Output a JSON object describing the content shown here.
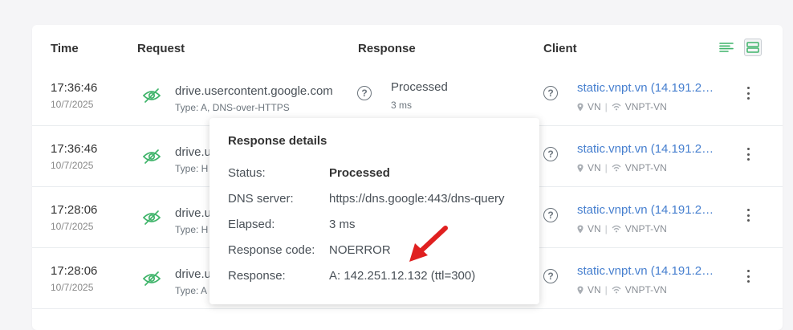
{
  "table": {
    "headers": {
      "time": "Time",
      "request": "Request",
      "response": "Response",
      "client": "Client"
    },
    "rows": [
      {
        "time": "17:36:46",
        "date": "10/7/2025",
        "domain": "drive.usercontent.google.com",
        "type": "Type: A, DNS-over-HTTPS",
        "status": "Processed",
        "elapsed": "3 ms",
        "client": "static.vnpt.vn (14.191.2…",
        "country": "VN",
        "network": "VNPT-VN"
      },
      {
        "time": "17:36:46",
        "date": "10/7/2025",
        "domain": "drive.u",
        "type": "Type: H",
        "status": "",
        "elapsed": "",
        "client": "static.vnpt.vn (14.191.2…",
        "country": "VN",
        "network": "VNPT-VN"
      },
      {
        "time": "17:28:06",
        "date": "10/7/2025",
        "domain": "drive.u",
        "type": "Type: H",
        "status": "",
        "elapsed": "",
        "client": "static.vnpt.vn (14.191.2…",
        "country": "VN",
        "network": "VNPT-VN"
      },
      {
        "time": "17:28:06",
        "date": "10/7/2025",
        "domain": "drive.u",
        "type": "Type: A",
        "status": "",
        "elapsed": "",
        "client": "static.vnpt.vn (14.191.2…",
        "country": "VN",
        "network": "VNPT-VN"
      }
    ]
  },
  "icons": {
    "request": "eye-slash-icon",
    "help": "question-circle-icon",
    "location": "map-pin-icon",
    "network": "wifi-icon",
    "menu": "kebab-menu-icon",
    "view_compact": "compact-view-icon",
    "view_default": "default-view-icon",
    "annotation": "red-arrow-icon"
  },
  "popup": {
    "title": "Response details",
    "rows": [
      {
        "label": "Status:",
        "value": "Processed"
      },
      {
        "label": "DNS server:",
        "value": "https://dns.google:443/dns-query"
      },
      {
        "label": "Elapsed:",
        "value": "3 ms"
      },
      {
        "label": "Response code:",
        "value": "NOERROR"
      },
      {
        "label": "Response:",
        "value": "A: 142.251.12.132 (ttl=300)"
      }
    ]
  },
  "colors": {
    "accent_green": "#3fb46a",
    "link_blue": "#467fcf",
    "arrow_red": "#e02020"
  }
}
